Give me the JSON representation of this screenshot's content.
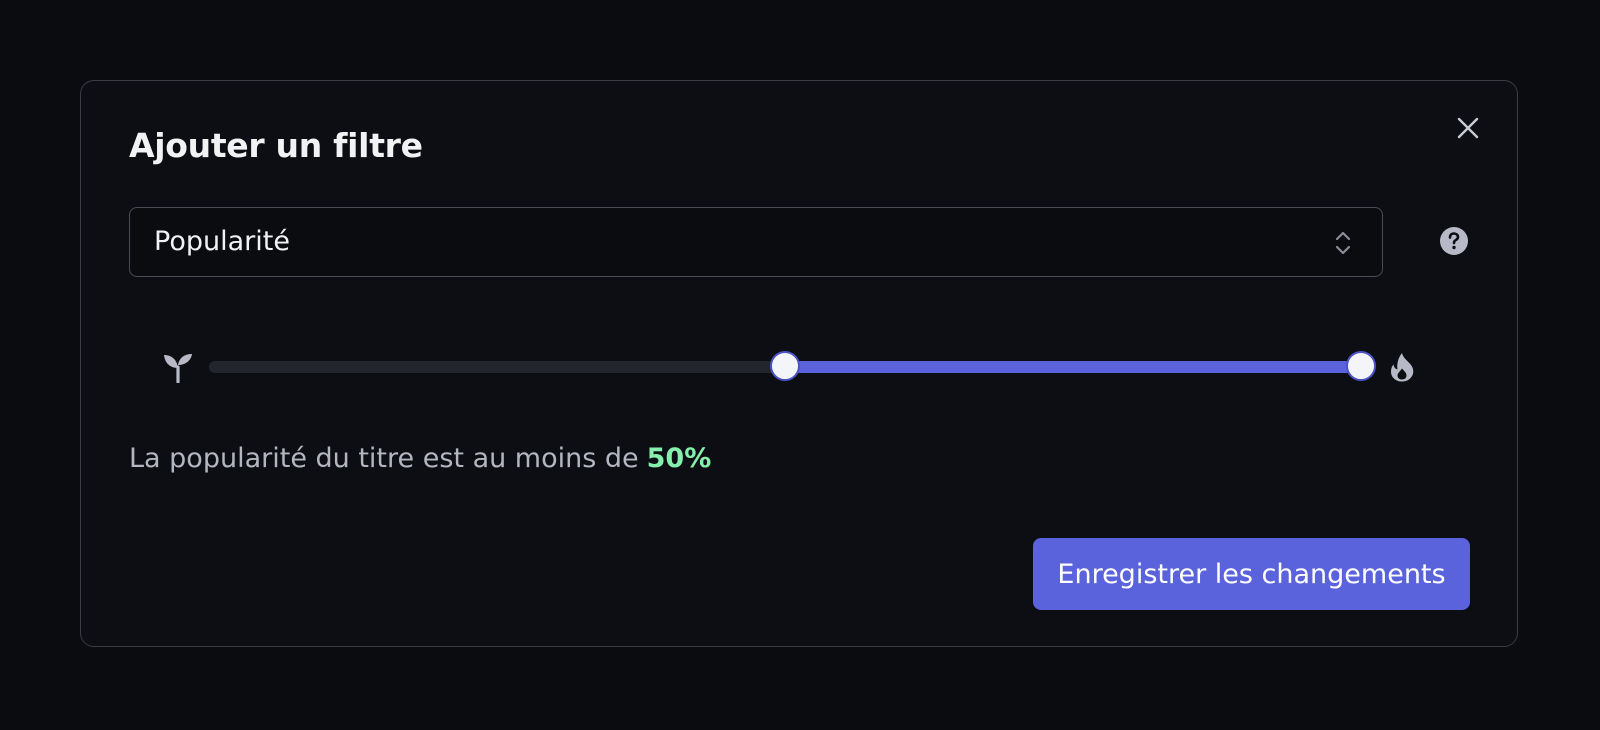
{
  "dialog": {
    "title": "Ajouter un filtre",
    "close_icon": "close-icon"
  },
  "filter_select": {
    "value": "Popularité",
    "icon": "chevron-up-down-icon"
  },
  "help": {
    "icon": "question-circle-icon"
  },
  "range_slider": {
    "min_icon": "sprout-icon",
    "max_icon": "flame-icon",
    "lower_value_percent": 50,
    "upper_value_percent": 100
  },
  "description": {
    "text": "La popularité du titre est au moins de",
    "value": "50%"
  },
  "actions": {
    "save_label": "Enregistrer les changements"
  },
  "colors": {
    "accent": "#5a63db",
    "highlight_value": "#86efac",
    "background": "#0d0e13",
    "border": "#3a3c44"
  }
}
